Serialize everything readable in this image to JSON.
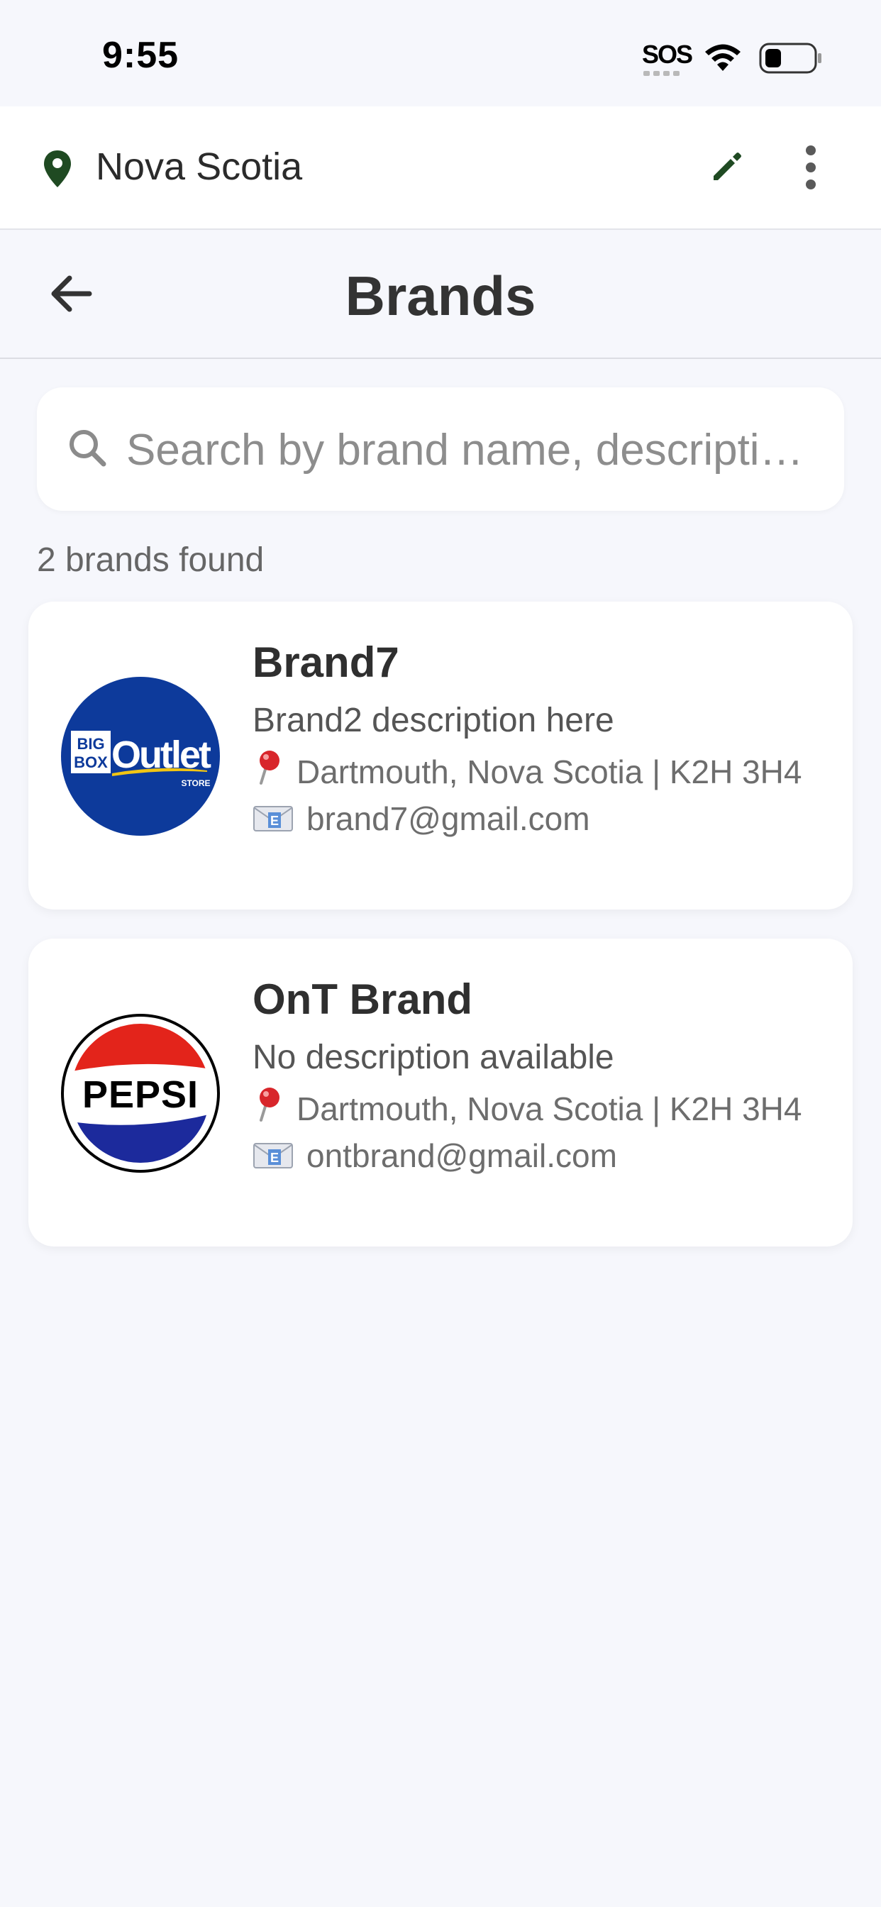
{
  "status_bar": {
    "time": "9:55",
    "sos": "SOS"
  },
  "location": {
    "name": "Nova Scotia"
  },
  "header": {
    "title": "Brands"
  },
  "search": {
    "placeholder": "Search by brand name, descripti…"
  },
  "results": {
    "count_text": "2 brands found"
  },
  "brands": [
    {
      "name": "Brand7",
      "description": "Brand2 description here",
      "address": "Dartmouth, Nova Scotia | K2H 3H4",
      "email": "brand7@gmail.com",
      "logo": {
        "big": "BIG",
        "box": "BOX",
        "word": "Outlet",
        "store": "STORE",
        "color": "#0d3a9b"
      }
    },
    {
      "name": "OnT Brand",
      "description": "No description available",
      "address": "Dartmouth, Nova Scotia | K2H 3H4",
      "email": "ontbrand@gmail.com",
      "logo": {
        "word": "PEPSI",
        "red": "#e3241b",
        "blue": "#1c2a9c"
      }
    }
  ],
  "colors": {
    "accent_green": "#1f4a22",
    "background": "#f6f7fc"
  },
  "icons": {
    "location": "location-pin-icon",
    "edit": "pencil-icon",
    "more": "more-vertical-icon",
    "back": "back-arrow-icon",
    "search": "search-icon",
    "address": "round-pushpin-emoji",
    "email": "envelope-emoji"
  }
}
